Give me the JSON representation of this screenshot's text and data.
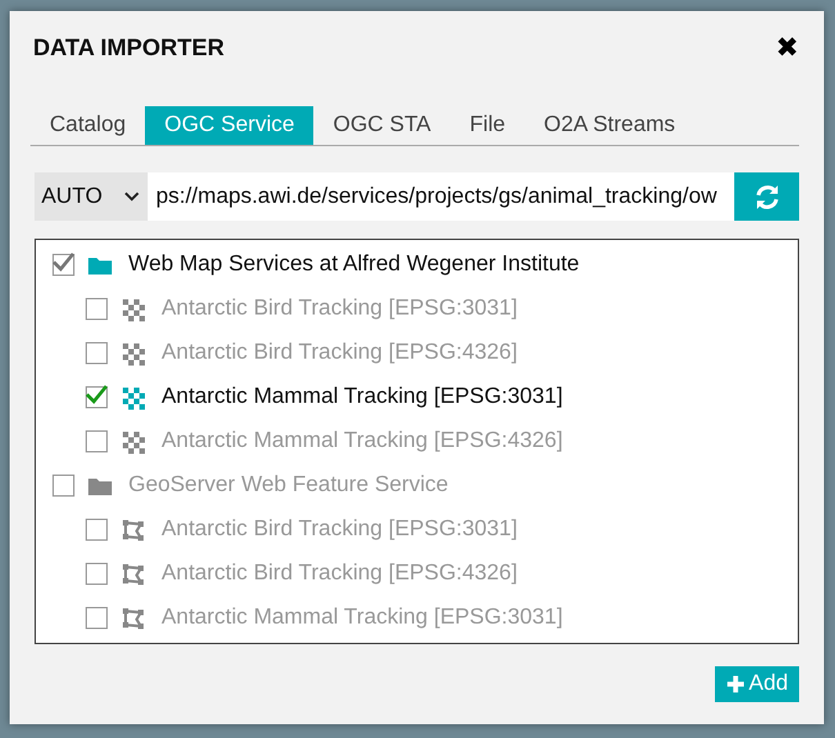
{
  "dialog": {
    "title": "DATA IMPORTER",
    "close": "✖"
  },
  "tabs": [
    {
      "label": "Catalog",
      "selected": false
    },
    {
      "label": "OGC Service",
      "selected": true
    },
    {
      "label": "OGC STA",
      "selected": false
    },
    {
      "label": "File",
      "selected": false
    },
    {
      "label": "O2A Streams",
      "selected": false
    }
  ],
  "source": {
    "mode": "AUTO",
    "url": "ps://maps.awi.de/services/projects/gs/animal_tracking/ow"
  },
  "tree": [
    {
      "label": "Web Map Services at Alfred Wegener Institute",
      "kind": "folder",
      "checked": true,
      "children": [
        {
          "label": "Antarctic Bird Tracking [EPSG:3031]",
          "kind": "raster",
          "checked": false
        },
        {
          "label": "Antarctic Bird Tracking [EPSG:4326]",
          "kind": "raster",
          "checked": false
        },
        {
          "label": "Antarctic Mammal Tracking [EPSG:3031]",
          "kind": "raster",
          "checked": true
        },
        {
          "label": "Antarctic Mammal Tracking [EPSG:4326]",
          "kind": "raster",
          "checked": false
        }
      ]
    },
    {
      "label": "GeoServer Web Feature Service",
      "kind": "folder",
      "checked": false,
      "children": [
        {
          "label": "Antarctic Bird Tracking [EPSG:3031]",
          "kind": "vector",
          "checked": false
        },
        {
          "label": "Antarctic Bird Tracking [EPSG:4326]",
          "kind": "vector",
          "checked": false
        },
        {
          "label": "Antarctic Mammal Tracking [EPSG:3031]",
          "kind": "vector",
          "checked": false
        }
      ]
    }
  ],
  "add_button": "Add"
}
